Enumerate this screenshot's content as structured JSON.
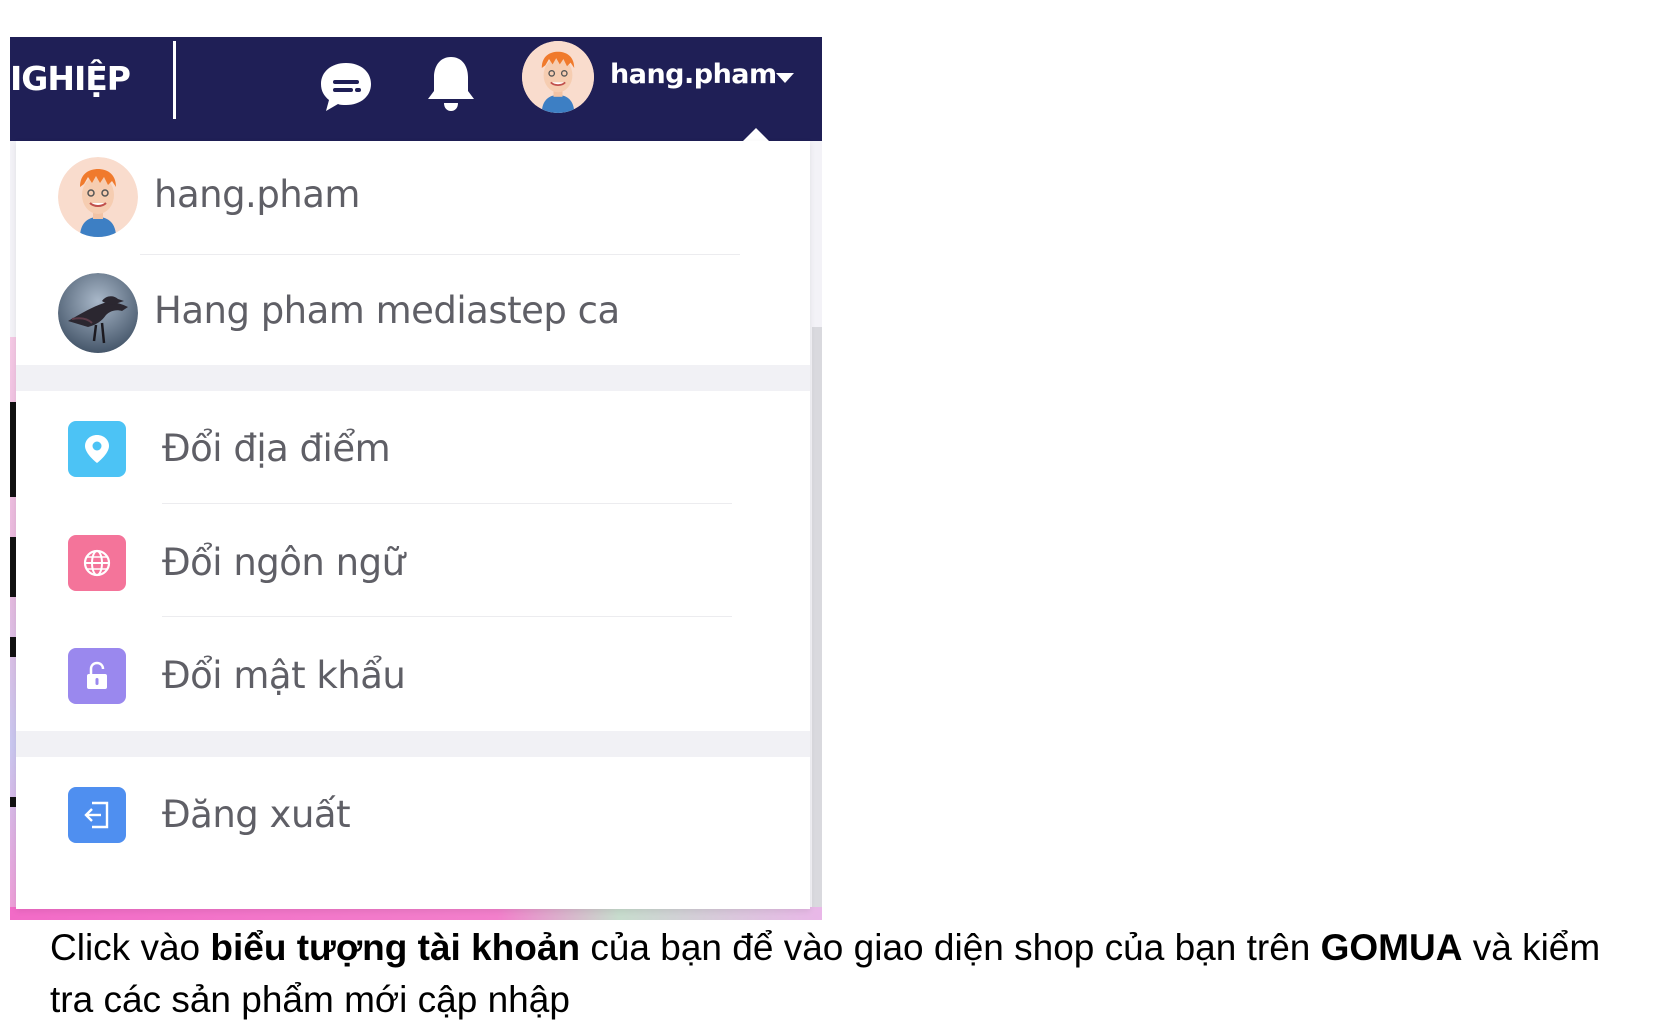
{
  "header": {
    "nav_partial_label": "IGHIỆP",
    "username": "hang.pham",
    "icons": {
      "chat": "chat-bubble-icon",
      "notifications": "bell-icon",
      "dropdown": "caret-down-icon"
    }
  },
  "dropdown": {
    "accounts": [
      {
        "name": "hang.pham",
        "avatar": "cartoon-boy-avatar"
      },
      {
        "name": "Hang pham mediastep ca",
        "avatar": "bird-photo-avatar"
      }
    ],
    "settings": [
      {
        "label": "Đổi địa điểm",
        "icon": "location-pin-icon",
        "color": "#4cc3f5"
      },
      {
        "label": "Đổi ngôn ngữ",
        "icon": "globe-icon",
        "color": "#f4749a"
      },
      {
        "label": "Đổi mật khẩu",
        "icon": "lock-icon",
        "color": "#9a88ee"
      }
    ],
    "logout": {
      "label": "Đăng xuất",
      "icon": "logout-icon",
      "color": "#4f8ff0"
    }
  },
  "caption": {
    "part1": "Click vào ",
    "bold1": "biểu tượng tài khoản",
    "part2": " của bạn để vào giao diện shop của bạn trên ",
    "bold2": "GOMUA",
    "part3": " và kiểm tra các sản phẩm mới cập nhập"
  },
  "colors": {
    "topbar": "#1f1f56",
    "menu_text": "#5f5f66"
  }
}
